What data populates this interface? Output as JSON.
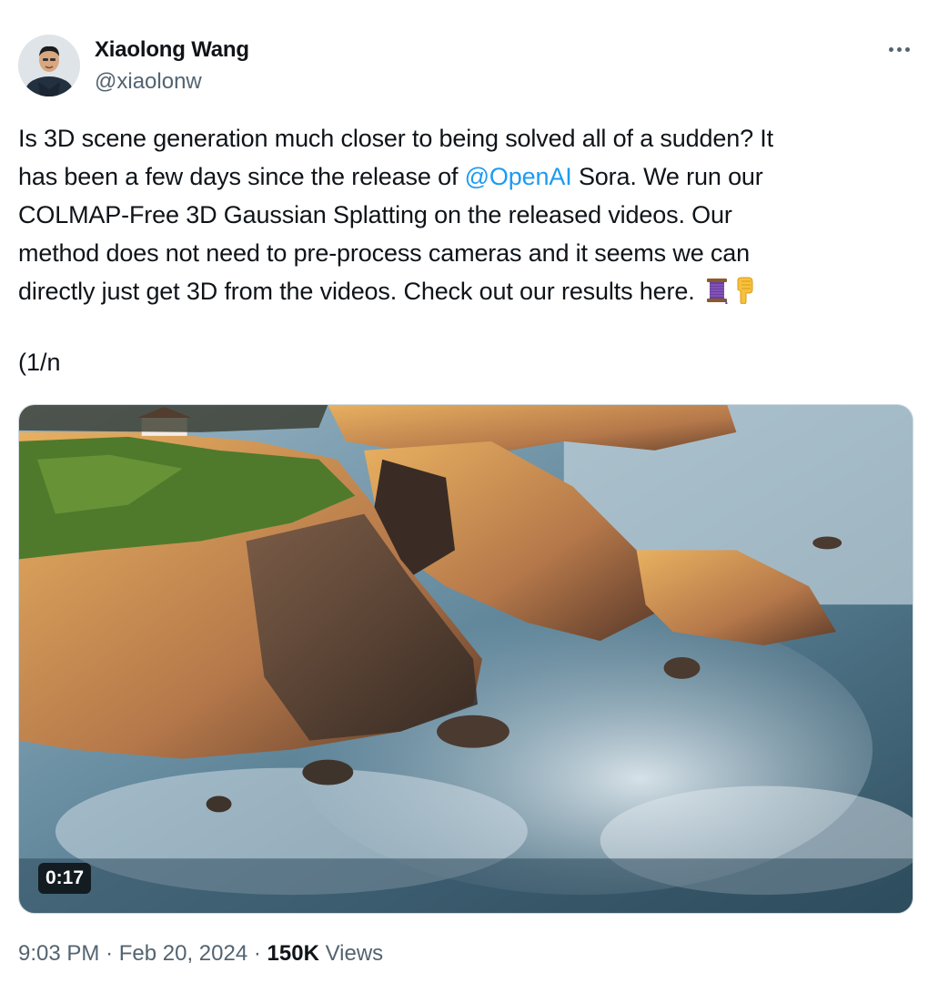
{
  "author": {
    "display_name": "Xiaolong Wang",
    "handle": "@xiaolonw",
    "avatar_icon": "profile-photo"
  },
  "more_icon": "ellipsis-icon",
  "tweet": {
    "lines": [
      {
        "text": "Is 3D scene generation much closer to being solved all of a sudden? It"
      },
      {
        "before": "has been a few days since the release of ",
        "mention": "@OpenAI",
        "after": " Sora. We run our"
      },
      {
        "text": "COLMAP-Free 3D Gaussian Splatting on the released videos. Our"
      },
      {
        "text": "method does not need to pre-process cameras and it seems we can"
      },
      {
        "text": "directly just get 3D from the videos. Check out our results here. ",
        "emojis": [
          "thread-spool-icon",
          "pointing-down-icon"
        ]
      }
    ],
    "thread_marker": "(1/n"
  },
  "media": {
    "type": "video",
    "duration": "0:17",
    "description_icon": "video-thumbnail"
  },
  "footer": {
    "time": "9:03 PM",
    "separator": "·",
    "date": "Feb 20, 2024",
    "views_count": "150K",
    "views_label": "Views"
  },
  "colors": {
    "text": "#0f1419",
    "secondary": "#536471",
    "link": "#1d9bf0"
  }
}
